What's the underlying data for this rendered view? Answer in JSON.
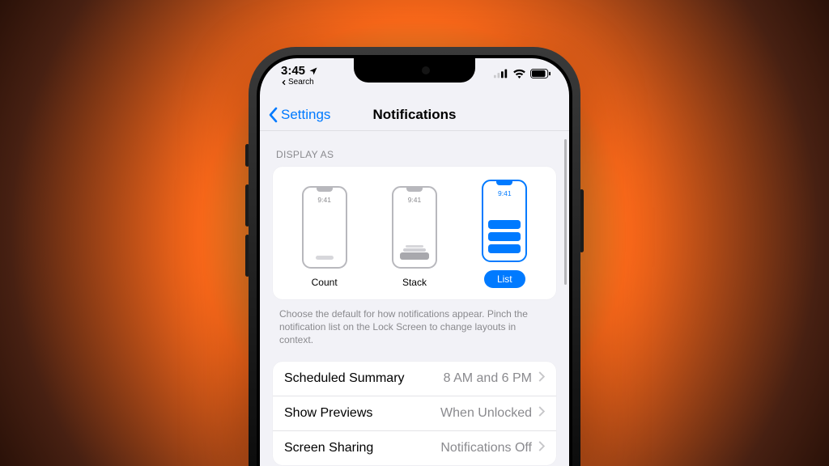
{
  "status": {
    "time": "3:45",
    "back_app": "Search"
  },
  "nav": {
    "back": "Settings",
    "title": "Notifications"
  },
  "display_as": {
    "header": "DISPLAY AS",
    "preview_time": "9:41",
    "options": {
      "count": "Count",
      "stack": "Stack",
      "list": "List"
    },
    "footer": "Choose the default for how notifications appear. Pinch the notification list on the Lock Screen to change layouts in context."
  },
  "rows": {
    "scheduled_summary": {
      "label": "Scheduled Summary",
      "value": "8 AM and 6 PM"
    },
    "show_previews": {
      "label": "Show Previews",
      "value": "When Unlocked"
    },
    "screen_sharing": {
      "label": "Screen Sharing",
      "value": "Notifications Off"
    }
  }
}
